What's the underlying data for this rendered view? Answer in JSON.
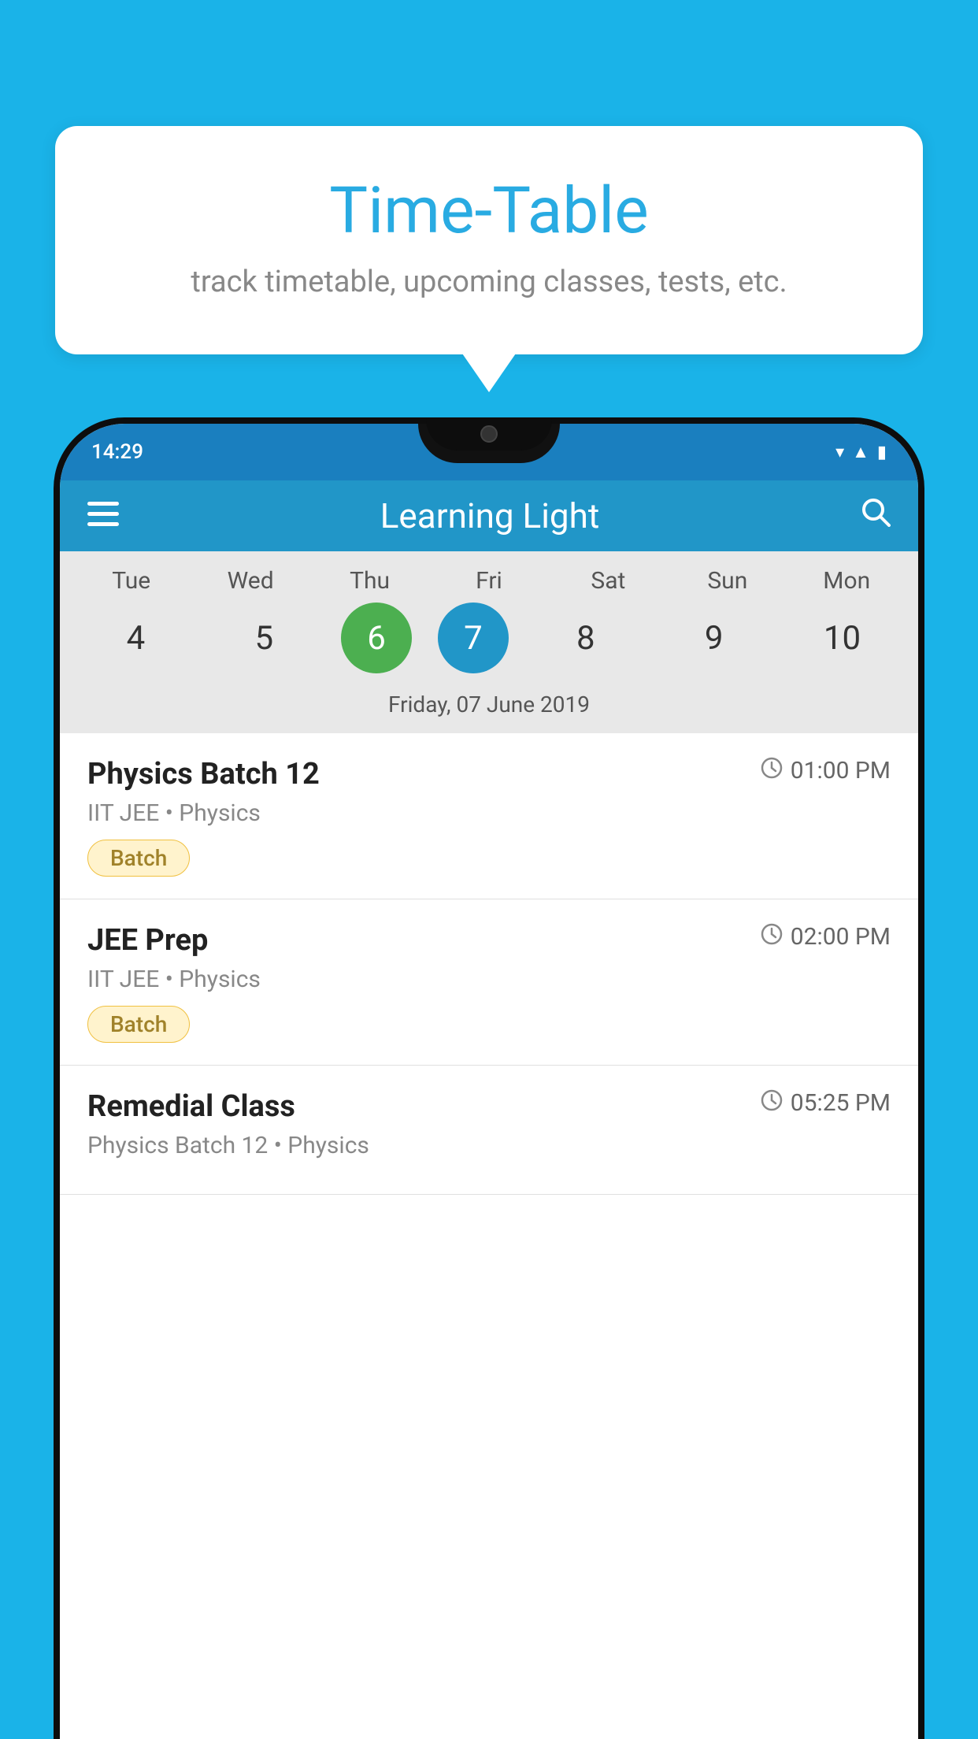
{
  "background_color": "#1ab3e8",
  "speech_bubble": {
    "title": "Time-Table",
    "subtitle": "track timetable, upcoming classes, tests, etc."
  },
  "app_bar": {
    "title": "Learning Light",
    "menu_label": "☰",
    "search_label": "🔍"
  },
  "status_bar": {
    "time": "14:29"
  },
  "calendar": {
    "days": [
      "Tue",
      "Wed",
      "Thu",
      "Fri",
      "Sat",
      "Sun",
      "Mon"
    ],
    "numbers": [
      "4",
      "5",
      "6",
      "7",
      "8",
      "9",
      "10"
    ],
    "today_index": 2,
    "selected_index": 3,
    "date_label": "Friday, 07 June 2019"
  },
  "schedule": [
    {
      "title": "Physics Batch 12",
      "time": "01:00 PM",
      "subtitle": "IIT JEE • Physics",
      "badge": "Batch"
    },
    {
      "title": "JEE Prep",
      "time": "02:00 PM",
      "subtitle": "IIT JEE • Physics",
      "badge": "Batch"
    },
    {
      "title": "Remedial Class",
      "time": "05:25 PM",
      "subtitle": "Physics Batch 12 • Physics",
      "badge": ""
    }
  ]
}
